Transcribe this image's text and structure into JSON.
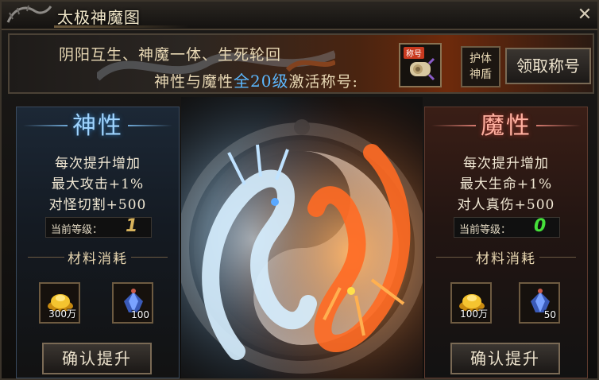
{
  "window": {
    "title": "太极神魔图",
    "close_icon": "close-icon"
  },
  "banner": {
    "line1": "阴阳互生、神魔一体、生死轮回",
    "line2_pre": "神性与魔性",
    "line2_hl": "全20级",
    "line2_post": "激活称号:",
    "title_item_tag": "称号",
    "shield_label_1": "护体",
    "shield_label_2": "神盾",
    "claim_button": "领取称号"
  },
  "divine": {
    "title": "神性",
    "stat1": "每次提升增加",
    "stat2": "最大攻击+1%",
    "stat3": "对怪切割+500",
    "level_label": "当前等级：",
    "level_value": "1",
    "materials_title": "材料消耗",
    "gold_count": "300万",
    "gem_count": "100",
    "confirm_button": "确认提升"
  },
  "demon": {
    "title": "魔性",
    "stat1": "每次提升增加",
    "stat2": "最大生命+1%",
    "stat3": "对人真伤+500",
    "level_label": "当前等级：",
    "level_value": "0",
    "materials_title": "材料消耗",
    "gold_count": "100万",
    "gem_count": "50",
    "confirm_button": "确认提升"
  },
  "colors": {
    "divine_accent": "#9fd4ff",
    "demon_accent": "#ffb0a0",
    "highlight": "#5cb8ff",
    "level_green": "#45e03a"
  }
}
